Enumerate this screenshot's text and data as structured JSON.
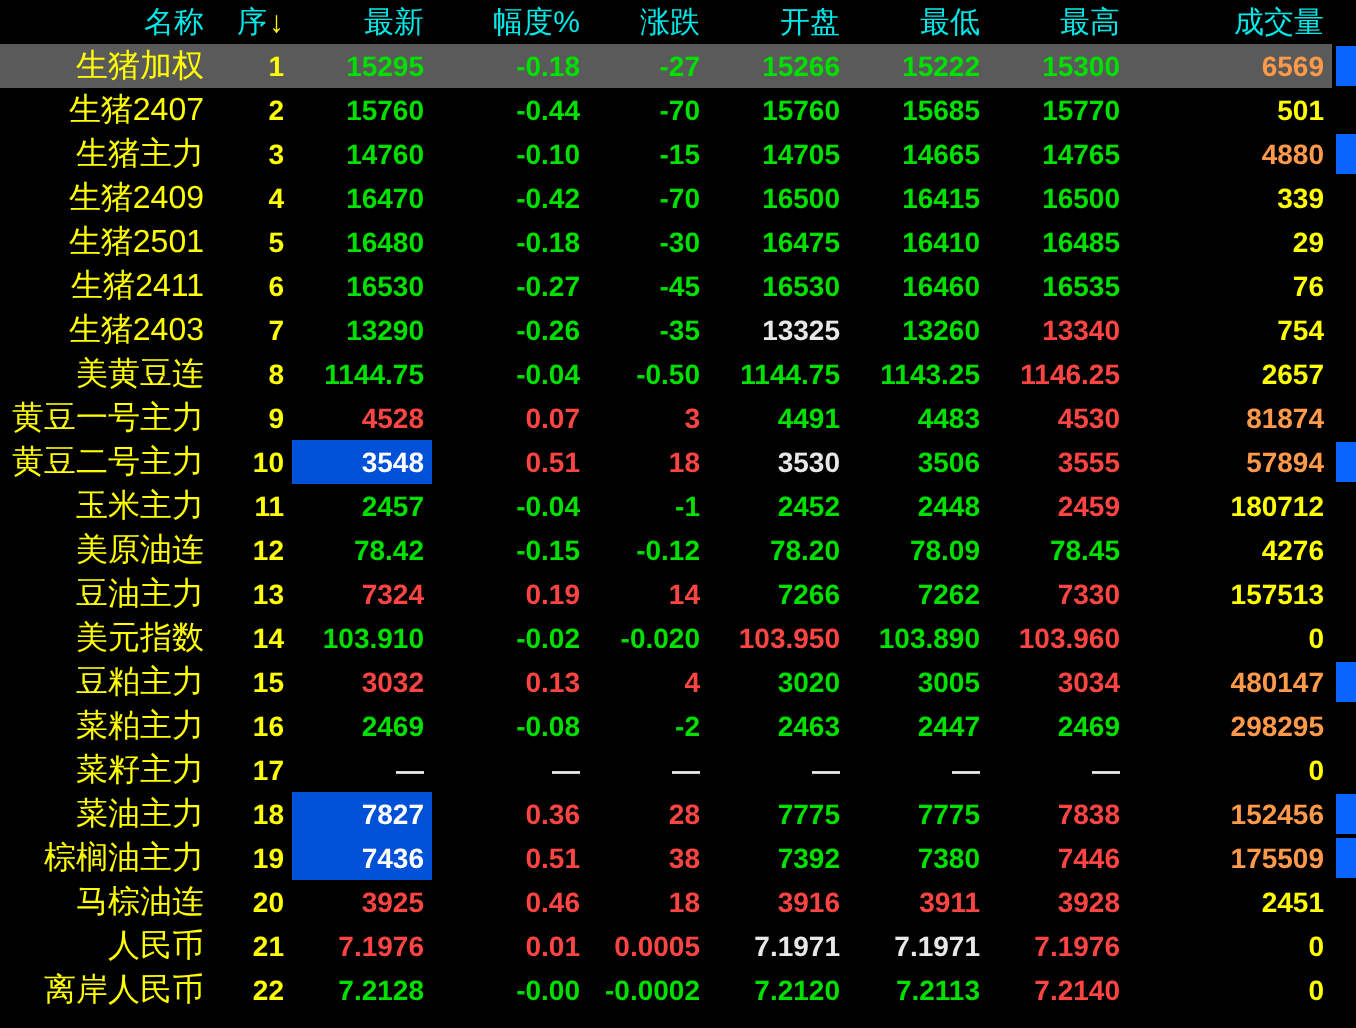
{
  "columns": [
    {
      "label": "名称"
    },
    {
      "label": "序",
      "sort_arrow": "↓"
    },
    {
      "label": "最新"
    },
    {
      "label": "幅度%"
    },
    {
      "label": "涨跌"
    },
    {
      "label": "开盘"
    },
    {
      "label": "最低"
    },
    {
      "label": "最高"
    },
    {
      "label": "成交量"
    }
  ],
  "rows": [
    {
      "selected": true,
      "name": "生猪加权",
      "seq": "1",
      "highlight": false,
      "marker": true,
      "cells": [
        {
          "text": "15295",
          "color": "#00e000"
        },
        {
          "text": "-0.18",
          "color": "#00e000"
        },
        {
          "text": "-27",
          "color": "#00e000"
        },
        {
          "text": "15266",
          "color": "#00e000"
        },
        {
          "text": "15222",
          "color": "#00e000"
        },
        {
          "text": "15300",
          "color": "#00e000"
        }
      ],
      "volume": {
        "text": "6569",
        "large": true
      }
    },
    {
      "selected": false,
      "name": "生猪2407",
      "seq": "2",
      "highlight": false,
      "marker": false,
      "cells": [
        {
          "text": "15760",
          "color": "#00e000"
        },
        {
          "text": "-0.44",
          "color": "#00e000"
        },
        {
          "text": "-70",
          "color": "#00e000"
        },
        {
          "text": "15760",
          "color": "#00e000"
        },
        {
          "text": "15685",
          "color": "#00e000"
        },
        {
          "text": "15770",
          "color": "#00e000"
        }
      ],
      "volume": {
        "text": "501",
        "large": false
      }
    },
    {
      "selected": false,
      "name": "生猪主力",
      "seq": "3",
      "highlight": false,
      "marker": true,
      "cells": [
        {
          "text": "14760",
          "color": "#00e000"
        },
        {
          "text": "-0.10",
          "color": "#00e000"
        },
        {
          "text": "-15",
          "color": "#00e000"
        },
        {
          "text": "14705",
          "color": "#00e000"
        },
        {
          "text": "14665",
          "color": "#00e000"
        },
        {
          "text": "14765",
          "color": "#00e000"
        }
      ],
      "volume": {
        "text": "4880",
        "large": true
      }
    },
    {
      "selected": false,
      "name": "生猪2409",
      "seq": "4",
      "highlight": false,
      "marker": false,
      "cells": [
        {
          "text": "16470",
          "color": "#00e000"
        },
        {
          "text": "-0.42",
          "color": "#00e000"
        },
        {
          "text": "-70",
          "color": "#00e000"
        },
        {
          "text": "16500",
          "color": "#00e000"
        },
        {
          "text": "16415",
          "color": "#00e000"
        },
        {
          "text": "16500",
          "color": "#00e000"
        }
      ],
      "volume": {
        "text": "339",
        "large": false
      }
    },
    {
      "selected": false,
      "name": "生猪2501",
      "seq": "5",
      "highlight": false,
      "marker": false,
      "cells": [
        {
          "text": "16480",
          "color": "#00e000"
        },
        {
          "text": "-0.18",
          "color": "#00e000"
        },
        {
          "text": "-30",
          "color": "#00e000"
        },
        {
          "text": "16475",
          "color": "#00e000"
        },
        {
          "text": "16410",
          "color": "#00e000"
        },
        {
          "text": "16485",
          "color": "#00e000"
        }
      ],
      "volume": {
        "text": "29",
        "large": false
      }
    },
    {
      "selected": false,
      "name": "生猪2411",
      "seq": "6",
      "highlight": false,
      "marker": false,
      "cells": [
        {
          "text": "16530",
          "color": "#00e000"
        },
        {
          "text": "-0.27",
          "color": "#00e000"
        },
        {
          "text": "-45",
          "color": "#00e000"
        },
        {
          "text": "16530",
          "color": "#00e000"
        },
        {
          "text": "16460",
          "color": "#00e000"
        },
        {
          "text": "16535",
          "color": "#00e000"
        }
      ],
      "volume": {
        "text": "76",
        "large": false
      }
    },
    {
      "selected": false,
      "name": "生猪2403",
      "seq": "7",
      "highlight": false,
      "marker": false,
      "cells": [
        {
          "text": "13290",
          "color": "#00e000"
        },
        {
          "text": "-0.26",
          "color": "#00e000"
        },
        {
          "text": "-35",
          "color": "#00e000"
        },
        {
          "text": "13325",
          "color": "#e8e8e8"
        },
        {
          "text": "13260",
          "color": "#00e000"
        },
        {
          "text": "13340",
          "color": "#ff4444"
        }
      ],
      "volume": {
        "text": "754",
        "large": false
      }
    },
    {
      "selected": false,
      "name": "美黄豆连",
      "seq": "8",
      "highlight": false,
      "marker": false,
      "cells": [
        {
          "text": "1144.75",
          "color": "#00e000"
        },
        {
          "text": "-0.04",
          "color": "#00e000"
        },
        {
          "text": "-0.50",
          "color": "#00e000"
        },
        {
          "text": "1144.75",
          "color": "#00e000"
        },
        {
          "text": "1143.25",
          "color": "#00e000"
        },
        {
          "text": "1146.25",
          "color": "#ff4444"
        }
      ],
      "volume": {
        "text": "2657",
        "large": false
      }
    },
    {
      "selected": false,
      "name": "黄豆一号主力",
      "seq": "9",
      "highlight": false,
      "marker": false,
      "cells": [
        {
          "text": "4528",
          "color": "#ff4444"
        },
        {
          "text": "0.07",
          "color": "#ff4444"
        },
        {
          "text": "3",
          "color": "#ff4444"
        },
        {
          "text": "4491",
          "color": "#00e000"
        },
        {
          "text": "4483",
          "color": "#00e000"
        },
        {
          "text": "4530",
          "color": "#ff4444"
        }
      ],
      "volume": {
        "text": "81874",
        "large": true
      }
    },
    {
      "selected": false,
      "name": "黄豆二号主力",
      "seq": "10",
      "highlight": true,
      "marker": true,
      "cells": [
        {
          "text": "3548"
        },
        {
          "text": "0.51",
          "color": "#ff4444"
        },
        {
          "text": "18",
          "color": "#ff4444"
        },
        {
          "text": "3530",
          "color": "#e8e8e8"
        },
        {
          "text": "3506",
          "color": "#00e000"
        },
        {
          "text": "3555",
          "color": "#ff4444"
        }
      ],
      "volume": {
        "text": "57894",
        "large": true
      }
    },
    {
      "selected": false,
      "name": "玉米主力",
      "seq": "11",
      "highlight": false,
      "marker": false,
      "cells": [
        {
          "text": "2457",
          "color": "#00e000"
        },
        {
          "text": "-0.04",
          "color": "#00e000"
        },
        {
          "text": "-1",
          "color": "#00e000"
        },
        {
          "text": "2452",
          "color": "#00e000"
        },
        {
          "text": "2448",
          "color": "#00e000"
        },
        {
          "text": "2459",
          "color": "#ff4444"
        }
      ],
      "volume": {
        "text": "180712",
        "large": false
      }
    },
    {
      "selected": false,
      "name": "美原油连",
      "seq": "12",
      "highlight": false,
      "marker": false,
      "cells": [
        {
          "text": "78.42",
          "color": "#00e000"
        },
        {
          "text": "-0.15",
          "color": "#00e000"
        },
        {
          "text": "-0.12",
          "color": "#00e000"
        },
        {
          "text": "78.20",
          "color": "#00e000"
        },
        {
          "text": "78.09",
          "color": "#00e000"
        },
        {
          "text": "78.45",
          "color": "#00e000"
        }
      ],
      "volume": {
        "text": "4276",
        "large": false
      }
    },
    {
      "selected": false,
      "name": "豆油主力",
      "seq": "13",
      "highlight": false,
      "marker": false,
      "cells": [
        {
          "text": "7324",
          "color": "#ff4444"
        },
        {
          "text": "0.19",
          "color": "#ff4444"
        },
        {
          "text": "14",
          "color": "#ff4444"
        },
        {
          "text": "7266",
          "color": "#00e000"
        },
        {
          "text": "7262",
          "color": "#00e000"
        },
        {
          "text": "7330",
          "color": "#ff4444"
        }
      ],
      "volume": {
        "text": "157513",
        "large": false
      }
    },
    {
      "selected": false,
      "name": "美元指数",
      "seq": "14",
      "highlight": false,
      "marker": false,
      "cells": [
        {
          "text": "103.910",
          "color": "#00e000"
        },
        {
          "text": "-0.02",
          "color": "#00e000"
        },
        {
          "text": "-0.020",
          "color": "#00e000"
        },
        {
          "text": "103.950",
          "color": "#ff4444"
        },
        {
          "text": "103.890",
          "color": "#00e000"
        },
        {
          "text": "103.960",
          "color": "#ff4444"
        }
      ],
      "volume": {
        "text": "0",
        "large": false
      }
    },
    {
      "selected": false,
      "name": "豆粕主力",
      "seq": "15",
      "highlight": false,
      "marker": true,
      "cells": [
        {
          "text": "3032",
          "color": "#ff4444"
        },
        {
          "text": "0.13",
          "color": "#ff4444"
        },
        {
          "text": "4",
          "color": "#ff4444"
        },
        {
          "text": "3020",
          "color": "#00e000"
        },
        {
          "text": "3005",
          "color": "#00e000"
        },
        {
          "text": "3034",
          "color": "#ff4444"
        }
      ],
      "volume": {
        "text": "480147",
        "large": true
      }
    },
    {
      "selected": false,
      "name": "菜粕主力",
      "seq": "16",
      "highlight": false,
      "marker": false,
      "cells": [
        {
          "text": "2469",
          "color": "#00e000"
        },
        {
          "text": "-0.08",
          "color": "#00e000"
        },
        {
          "text": "-2",
          "color": "#00e000"
        },
        {
          "text": "2463",
          "color": "#00e000"
        },
        {
          "text": "2447",
          "color": "#00e000"
        },
        {
          "text": "2469",
          "color": "#00e000"
        }
      ],
      "volume": {
        "text": "298295",
        "large": true
      }
    },
    {
      "selected": false,
      "name": "菜籽主力",
      "seq": "17",
      "highlight": false,
      "marker": false,
      "cells": [
        {
          "text": "—",
          "color": "#e8e8e8"
        },
        {
          "text": "—",
          "color": "#e8e8e8"
        },
        {
          "text": "—",
          "color": "#e8e8e8"
        },
        {
          "text": "—",
          "color": "#e8e8e8"
        },
        {
          "text": "—",
          "color": "#e8e8e8"
        },
        {
          "text": "—",
          "color": "#e8e8e8"
        }
      ],
      "volume": {
        "text": "0",
        "large": false
      }
    },
    {
      "selected": false,
      "name": "菜油主力",
      "seq": "18",
      "highlight": true,
      "marker": true,
      "cells": [
        {
          "text": "7827"
        },
        {
          "text": "0.36",
          "color": "#ff4444"
        },
        {
          "text": "28",
          "color": "#ff4444"
        },
        {
          "text": "7775",
          "color": "#00e000"
        },
        {
          "text": "7775",
          "color": "#00e000"
        },
        {
          "text": "7838",
          "color": "#ff4444"
        }
      ],
      "volume": {
        "text": "152456",
        "large": true
      }
    },
    {
      "selected": false,
      "name": "棕榈油主力",
      "seq": "19",
      "highlight": true,
      "marker": true,
      "cells": [
        {
          "text": "7436"
        },
        {
          "text": "0.51",
          "color": "#ff4444"
        },
        {
          "text": "38",
          "color": "#ff4444"
        },
        {
          "text": "7392",
          "color": "#00e000"
        },
        {
          "text": "7380",
          "color": "#00e000"
        },
        {
          "text": "7446",
          "color": "#ff4444"
        }
      ],
      "volume": {
        "text": "175509",
        "large": true
      }
    },
    {
      "selected": false,
      "name": "马棕油连",
      "seq": "20",
      "highlight": false,
      "marker": false,
      "cells": [
        {
          "text": "3925",
          "color": "#ff4444"
        },
        {
          "text": "0.46",
          "color": "#ff4444"
        },
        {
          "text": "18",
          "color": "#ff4444"
        },
        {
          "text": "3916",
          "color": "#ff4444"
        },
        {
          "text": "3911",
          "color": "#ff4444"
        },
        {
          "text": "3928",
          "color": "#ff4444"
        }
      ],
      "volume": {
        "text": "2451",
        "large": false
      }
    },
    {
      "selected": false,
      "name": "人民币",
      "seq": "21",
      "highlight": false,
      "marker": false,
      "cells": [
        {
          "text": "7.1976",
          "color": "#ff4444"
        },
        {
          "text": "0.01",
          "color": "#ff4444"
        },
        {
          "text": "0.0005",
          "color": "#ff4444"
        },
        {
          "text": "7.1971",
          "color": "#e8e8e8"
        },
        {
          "text": "7.1971",
          "color": "#e8e8e8"
        },
        {
          "text": "7.1976",
          "color": "#ff4444"
        }
      ],
      "volume": {
        "text": "0",
        "large": false
      }
    },
    {
      "selected": false,
      "name": "离岸人民币",
      "seq": "22",
      "highlight": false,
      "marker": false,
      "cells": [
        {
          "text": "7.2128",
          "color": "#00e000"
        },
        {
          "text": "-0.00",
          "color": "#00e000"
        },
        {
          "text": "-0.0002",
          "color": "#00e000"
        },
        {
          "text": "7.2120",
          "color": "#00e000"
        },
        {
          "text": "7.2113",
          "color": "#00e000"
        },
        {
          "text": "7.2140",
          "color": "#ff4444"
        }
      ],
      "volume": {
        "text": "0",
        "large": false
      }
    }
  ]
}
